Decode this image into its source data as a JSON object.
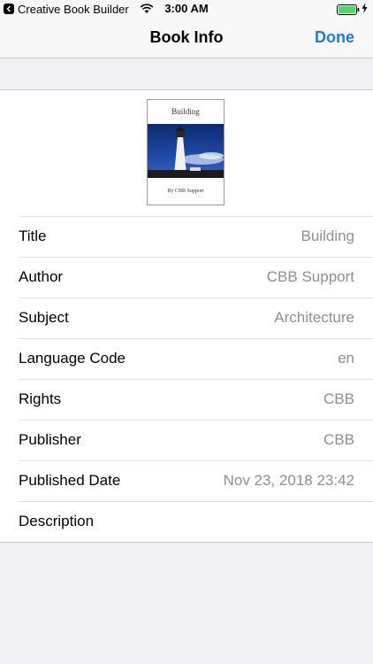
{
  "status_bar": {
    "app_name": "Creative Book Builder",
    "time": "3:00 AM"
  },
  "nav": {
    "title": "Book Info",
    "done_label": "Done"
  },
  "cover": {
    "title": "Building",
    "author_line": "By CBB Support"
  },
  "fields": [
    {
      "label": "Title",
      "value": "Building"
    },
    {
      "label": "Author",
      "value": "CBB Support"
    },
    {
      "label": "Subject",
      "value": "Architecture"
    },
    {
      "label": "Language Code",
      "value": "en"
    },
    {
      "label": "Rights",
      "value": "CBB"
    },
    {
      "label": "Publisher",
      "value": "CBB"
    },
    {
      "label": "Published Date",
      "value": "Nov 23, 2018 23:42"
    },
    {
      "label": "Description",
      "value": ""
    }
  ],
  "colors": {
    "accent": "#1a7ce0",
    "background": "#efeff4",
    "battery": "#4cd964"
  }
}
